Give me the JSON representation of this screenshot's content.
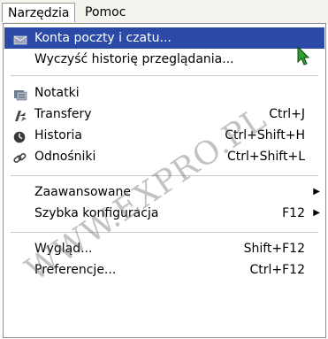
{
  "menubar": {
    "items": [
      {
        "label": "Narzędzia",
        "active": true
      },
      {
        "label": "Pomoc",
        "active": false
      }
    ]
  },
  "menu": {
    "items": [
      {
        "label": "Konta poczty i czatu...",
        "icon": "mail-icon",
        "highlighted": true
      },
      {
        "label": "Wyczyść historię przeglądania..."
      },
      {
        "label": "Notatki",
        "icon": "notes-icon"
      },
      {
        "label": "Transfery",
        "icon": "transfer-icon",
        "shortcut": "Ctrl+J"
      },
      {
        "label": "Historia",
        "icon": "clock-icon",
        "shortcut": "Ctrl+Shift+H"
      },
      {
        "label": "Odnośniki",
        "icon": "link-icon",
        "shortcut": "Ctrl+Shift+L"
      },
      {
        "label": "Zaawansowane",
        "submenu": true
      },
      {
        "label": "Szybka konfiguracja",
        "shortcut": "F12",
        "submenu": true
      },
      {
        "label": "Wygląd...",
        "shortcut": "Shift+F12"
      },
      {
        "label": "Preferencje...",
        "shortcut": "Ctrl+F12"
      }
    ]
  },
  "watermark": "WWW.EXPRO.PL",
  "colors": {
    "highlight": "#2b4aa7",
    "menubar": "#f4f3ee",
    "cursor": "#2e9f2e"
  }
}
